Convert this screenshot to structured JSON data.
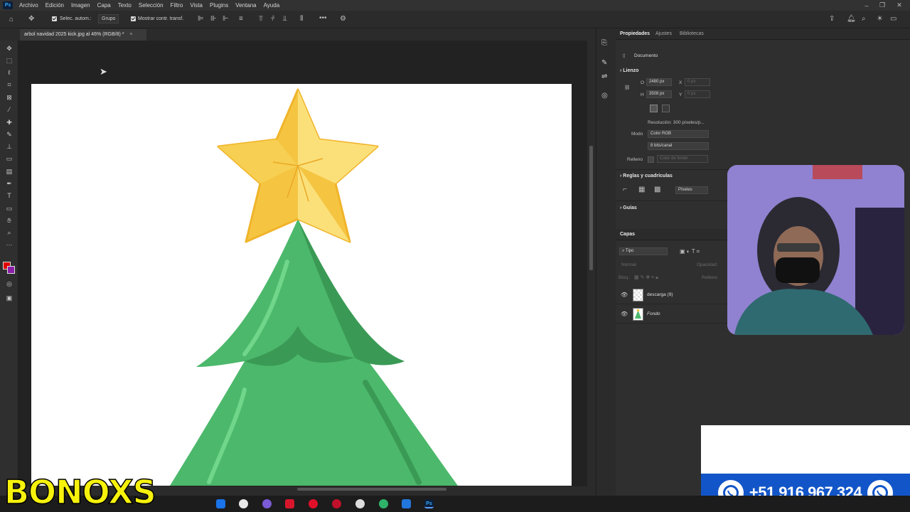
{
  "app": {
    "logo": "Ps"
  },
  "menubar": {
    "items": [
      "Archivo",
      "Edición",
      "Imagen",
      "Capa",
      "Texto",
      "Selección",
      "Filtro",
      "Vista",
      "Plugins",
      "Ventana",
      "Ayuda"
    ]
  },
  "options_bar": {
    "auto_select_label": "Selec. autom.:",
    "group_value": "Grupo",
    "show_transform_label": "Mostrar contr. transf."
  },
  "document_tab": {
    "title": "arbol navidad 2025 kick.jpg al 46% (RGB/8) *",
    "close": "×"
  },
  "properties": {
    "tabs": [
      "Propiedades",
      "Ajustes",
      "Bibliotecas"
    ],
    "doc_label": "Documento",
    "canvas_section": "Lienzo",
    "width_label": "O",
    "width_value": "2480 px",
    "height_label": "H",
    "height_value": "3508 px",
    "x_label": "X",
    "x_value": "0 px",
    "y_label": "Y",
    "y_value": "0 px",
    "resolution": "Resolución: 300 píxeles/p...",
    "mode_label": "Modo",
    "mode_value": "Color RGB",
    "bits_value": "8 bits/canal",
    "fill_label": "Relleno",
    "fill_value": "Color de fondo",
    "rulers_section": "Reglas y cuadrículas",
    "units_value": "Píxeles",
    "guides_section": "Guías"
  },
  "layers": {
    "panel_title": "Capas",
    "filter_value": "Tipo",
    "blend_value": "Normal",
    "opacity_label": "Opacidad:",
    "lock_label": "Bloq.:",
    "fill_label": "Relleno",
    "items": [
      {
        "name": "descarga (9)"
      },
      {
        "name": "Fondo"
      }
    ]
  },
  "overlay": {
    "brand": "BONOXS",
    "phone": "+51 916 967 324"
  },
  "colors": {
    "foreground": "#e00000",
    "background": "#8b1fa8",
    "star": "#f5c542",
    "tree": "#4cb86b",
    "tree_dark": "#3a9a55",
    "whatsapp_bar": "#1255c8"
  }
}
